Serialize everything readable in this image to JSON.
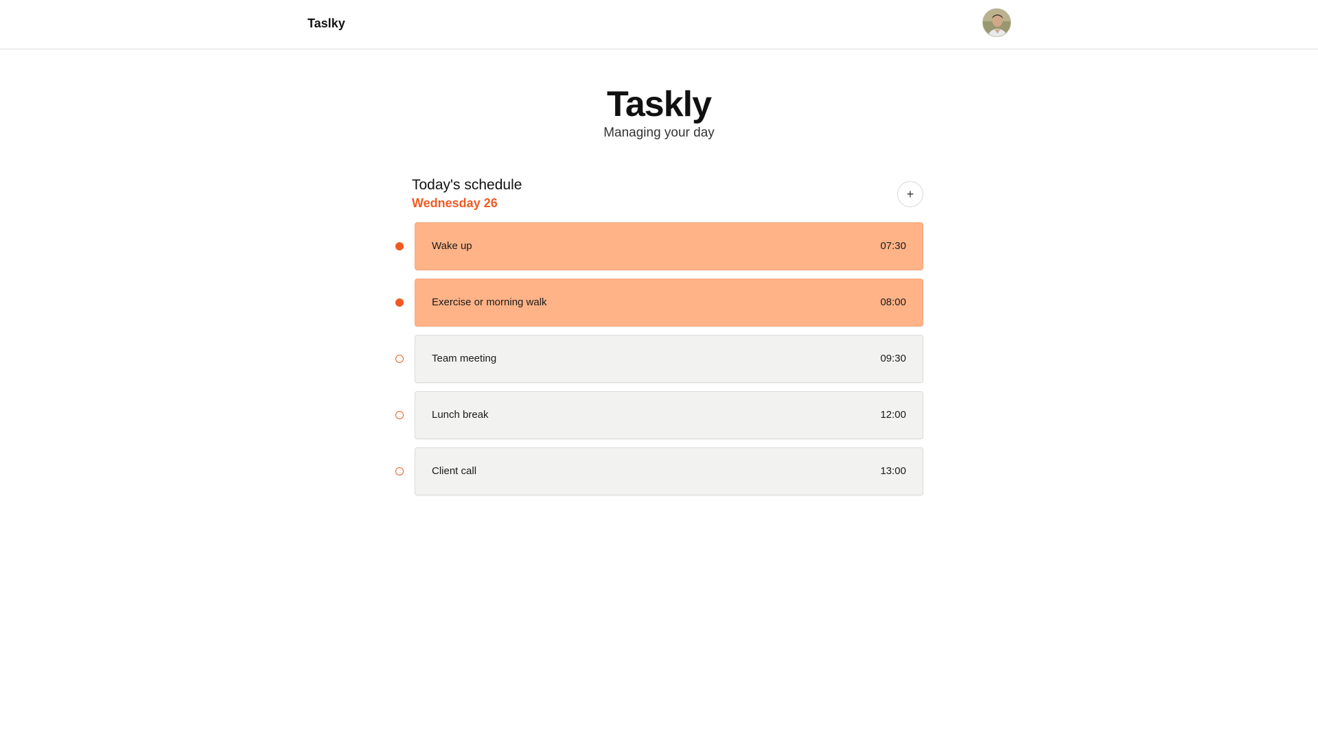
{
  "header": {
    "brand": "Taslky",
    "avatar_alt": "user-avatar"
  },
  "hero": {
    "title": "Taskly",
    "subtitle": "Managing your day"
  },
  "schedule": {
    "title": "Today's schedule",
    "date": "Wednesday 26",
    "add_button": "+",
    "tasks": [
      {
        "name": "Wake up",
        "time": "07:30",
        "done": true
      },
      {
        "name": "Exercise or morning walk",
        "time": "08:00",
        "done": true
      },
      {
        "name": "Team meeting",
        "time": "09:30",
        "done": false
      },
      {
        "name": "Lunch break",
        "time": "12:00",
        "done": false
      },
      {
        "name": "Client call",
        "time": "13:00",
        "done": false
      }
    ]
  },
  "colors": {
    "accent": "#f05a22",
    "done_card": "#ffb387",
    "pending_card": "#f2f2f1"
  }
}
